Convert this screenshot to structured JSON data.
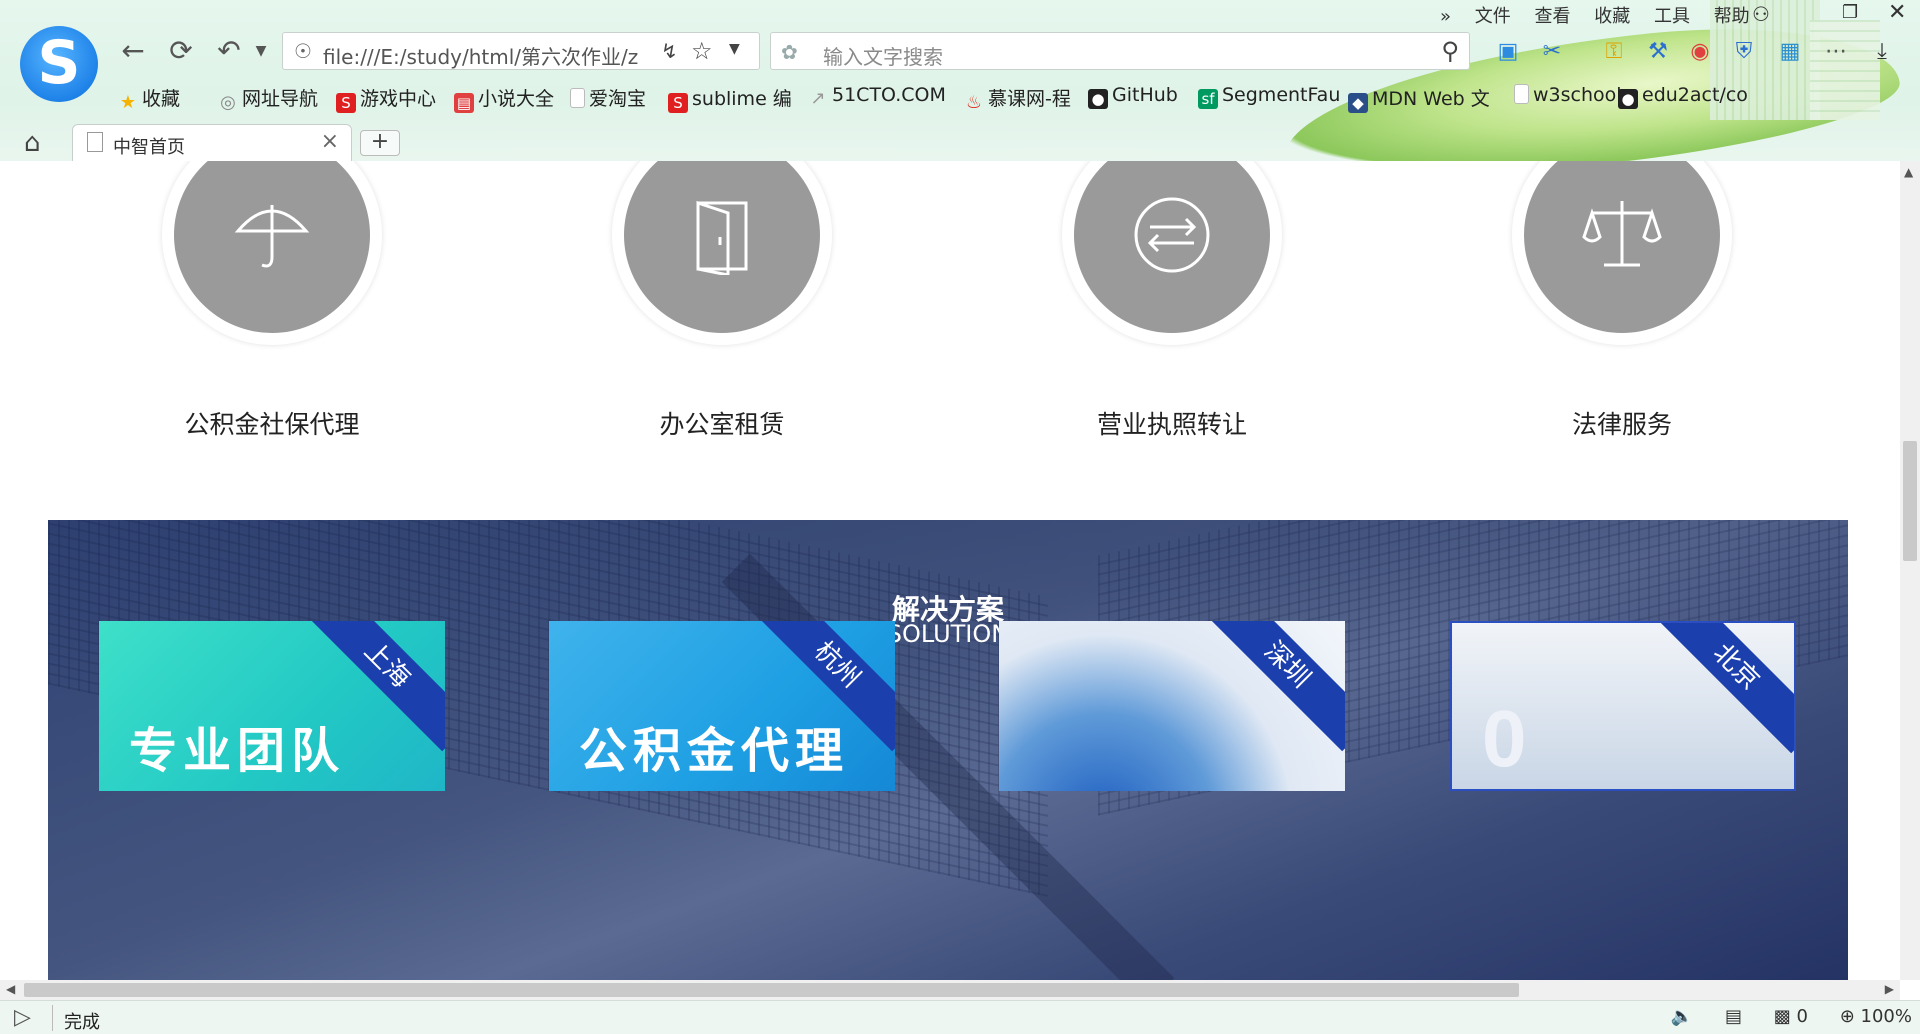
{
  "browser": {
    "menu": [
      "文件",
      "查看",
      "收藏",
      "工具",
      "帮助"
    ],
    "url": "file:///E:/study/html/第六次作业/z",
    "search_placeholder": "输入文字搜索",
    "bookmarks": [
      {
        "label": "收藏",
        "icon": "star-icon",
        "color": "#f5b301"
      },
      {
        "label": "网址导航",
        "icon": "globe-icon",
        "color": "#888888"
      },
      {
        "label": "游戏中心",
        "icon": "game-icon",
        "color": "#e02020"
      },
      {
        "label": "小说大全",
        "icon": "book-icon",
        "color": "#e04040"
      },
      {
        "label": "爱淘宝",
        "icon": "page-icon",
        "color": "#bbbbbb"
      },
      {
        "label": "sublime 编",
        "icon": "sogou-icon",
        "color": "#e02020"
      },
      {
        "label": "51CTO.COM",
        "icon": "link-icon",
        "color": "#999999"
      },
      {
        "label": "慕课网-程",
        "icon": "flame-icon",
        "color": "#e03020"
      },
      {
        "label": "GitHub",
        "icon": "github-icon",
        "color": "#222222"
      },
      {
        "label": "SegmentFau",
        "icon": "sf-icon",
        "color": "#009a61"
      },
      {
        "label": "MDN Web 文",
        "icon": "mdn-icon",
        "color": "#2a4f88"
      },
      {
        "label": "w3school",
        "icon": "page-icon",
        "color": "#bbbbbb"
      },
      {
        "label": "edu2act/co",
        "icon": "github-icon",
        "color": "#222222"
      }
    ],
    "tab": {
      "title": "中智首页"
    }
  },
  "services": [
    {
      "label": "公积金社保代理",
      "icon": "umbrella-icon"
    },
    {
      "label": "办公室租赁",
      "icon": "door-icon"
    },
    {
      "label": "营业执照转让",
      "icon": "exchange-icon"
    },
    {
      "label": "法律服务",
      "icon": "scales-icon"
    }
  ],
  "solution": {
    "title": "解决方案",
    "subtitle": "SOLUTION",
    "cards": [
      {
        "city": "上海",
        "overlay": "专业团队",
        "bg": "linear-gradient(135deg,#3ee0c9 0%,#22c8c4 60%,#1fb6c8 100%)"
      },
      {
        "city": "杭州",
        "overlay": "公积金代理",
        "bg": "linear-gradient(135deg,#3fb3ec 0%,#1e9fe3 60%,#1588d6 100%)"
      },
      {
        "city": "深圳",
        "overlay": "",
        "bg": "radial-gradient(circle at 30% 120%,#1b5cc0 0%,#5f9ad8 35%,#dfe8f4 60%,#f3f6fb 100%)"
      },
      {
        "city": "北京",
        "overlay": "0",
        "bg": "linear-gradient(180deg,#f1f4f8 0%,#c9d6e6 100%)"
      }
    ]
  },
  "status": {
    "text": "完成",
    "zoom": "100%",
    "count": "0"
  }
}
